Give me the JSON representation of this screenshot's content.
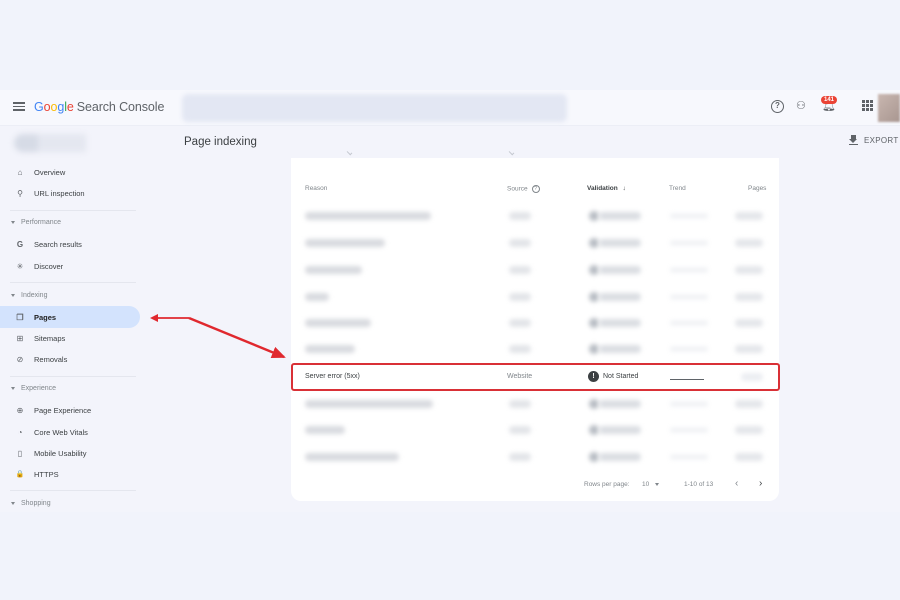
{
  "header": {
    "app_title_parts": [
      "G",
      "o",
      "o",
      "g",
      "l",
      "e"
    ],
    "app_title_suffix": "Search Console",
    "notifications_count": "141",
    "icons": [
      "menu-icon",
      "help-icon",
      "admin-icon",
      "notifications-icon",
      "apps-icon"
    ]
  },
  "page": {
    "title": "Page indexing",
    "export_label": "EXPORT"
  },
  "sidebar": {
    "items": [
      {
        "label": "Overview",
        "icon": "⌂"
      },
      {
        "label": "URL inspection",
        "icon": "⚲"
      },
      {
        "label": "Search results",
        "icon": "G"
      },
      {
        "label": "Discover",
        "icon": "✳"
      },
      {
        "label": "Pages",
        "icon": "❐",
        "active": true
      },
      {
        "label": "Sitemaps",
        "icon": "⊞"
      },
      {
        "label": "Removals",
        "icon": "⊘"
      },
      {
        "label": "Page Experience",
        "icon": "⊕"
      },
      {
        "label": "Core Web Vitals",
        "icon": "◔"
      },
      {
        "label": "Mobile Usability",
        "icon": "▯"
      },
      {
        "label": "HTTPS",
        "icon": "🔒"
      }
    ],
    "sections": [
      "Performance",
      "Indexing",
      "Experience",
      "Shopping"
    ]
  },
  "table": {
    "headers": {
      "reason": "Reason",
      "source": "Source",
      "validation": "Validation",
      "trend": "Trend",
      "pages": "Pages"
    },
    "sort_indicator": "↓",
    "highlighted_row": {
      "reason": "Server error (5xx)",
      "source": "Website",
      "validation_icon": "!",
      "validation": "Not Started"
    },
    "pagination": {
      "rows_per_page_label": "Rows per page:",
      "rows_per_page": "10",
      "range": "1-10 of 13",
      "prev": "‹",
      "next": "›"
    }
  },
  "annotation": {
    "color": "#e0282e"
  }
}
